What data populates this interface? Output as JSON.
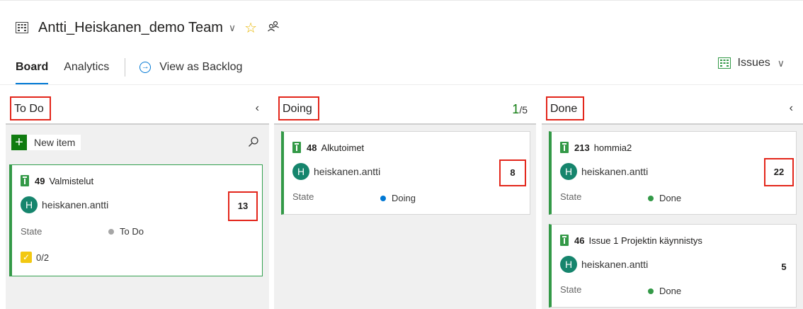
{
  "header": {
    "team_name": "Antti_Heiskanen_demo Team",
    "chevron": "∨",
    "star": "☆",
    "people": "ꝶ"
  },
  "tabs": {
    "board": "Board",
    "analytics": "Analytics",
    "backlog_link": "View as Backlog"
  },
  "issues_picker": {
    "label": "Issues",
    "chevron": "∨"
  },
  "colors": {
    "accent": "#0078d4",
    "issue_green": "#339947",
    "highlight_red": "#e3261b",
    "todo_dot": "#a6a6a6",
    "doing_dot": "#0078d4",
    "done_dot": "#339947"
  },
  "columns": {
    "todo": {
      "title": "To Do",
      "collapse": "‹",
      "new_item_label": "New item",
      "cards": [
        {
          "id": "49",
          "title": "Valmistelut",
          "avatar": "H",
          "assignee": "heiskanen.antti",
          "state_label": "State",
          "state": "To Do",
          "effort": "13",
          "checklist": "0/2"
        }
      ]
    },
    "doing": {
      "title": "Doing",
      "wip_current": "1",
      "wip_limit": "/5",
      "cards": [
        {
          "id": "48",
          "title": "Alkutoimet",
          "avatar": "H",
          "assignee": "heiskanen.antti",
          "state_label": "State",
          "state": "Doing",
          "effort": "8"
        }
      ]
    },
    "done": {
      "title": "Done",
      "collapse": "‹",
      "cards": [
        {
          "id": "213",
          "title": "hommia2",
          "avatar": "H",
          "assignee": "heiskanen.antti",
          "state_label": "State",
          "state": "Done",
          "effort": "22"
        },
        {
          "id": "46",
          "title": "Issue 1 Projektin käynnistys",
          "avatar": "H",
          "assignee": "heiskanen.antti",
          "state_label": "State",
          "state": "Done",
          "effort": "5"
        }
      ]
    }
  }
}
